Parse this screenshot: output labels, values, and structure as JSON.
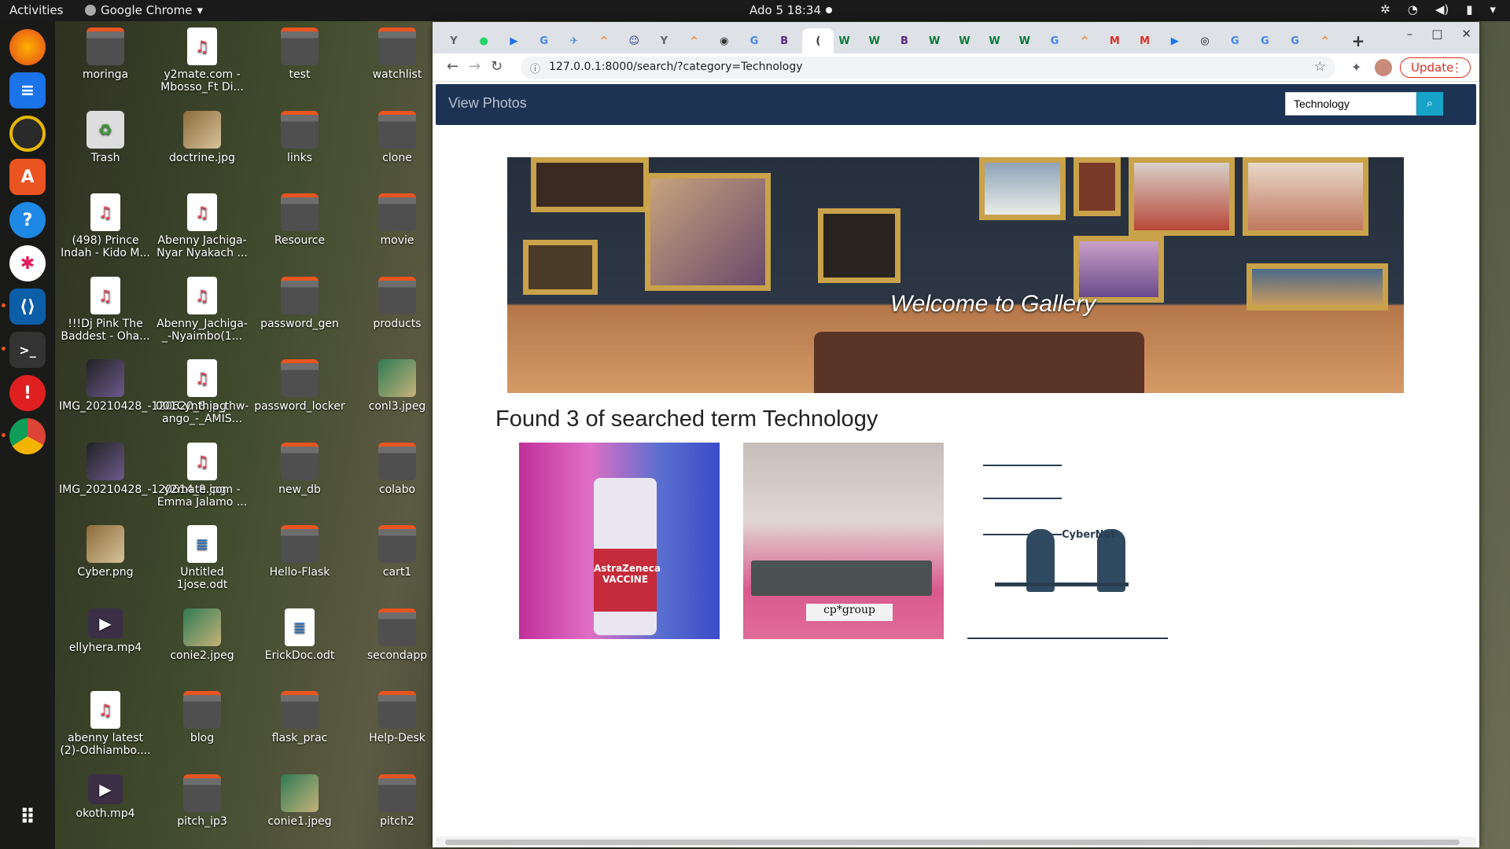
{
  "topbar": {
    "activities": "Activities",
    "app_name": "Google Chrome",
    "clock": "Ado 5  18:34"
  },
  "desktop": {
    "icons": [
      {
        "label": "moringa",
        "type": "folder"
      },
      {
        "label": "y2mate.com - Mbosso_Ft Di...",
        "type": "mp3"
      },
      {
        "label": "test",
        "type": "folder"
      },
      {
        "label": "watchlist",
        "type": "folder"
      },
      {
        "label": "Trash",
        "type": "trash"
      },
      {
        "label": "doctrine.jpg",
        "type": "image"
      },
      {
        "label": "links",
        "type": "folder"
      },
      {
        "label": "clone",
        "type": "folder"
      },
      {
        "label": "(498) Prince Indah - Kido M...",
        "type": "mp3"
      },
      {
        "label": "Abenny Jachiga-Nyar Nyakach ...",
        "type": "mp3"
      },
      {
        "label": "Resource",
        "type": "folder"
      },
      {
        "label": "movie",
        "type": "folder"
      },
      {
        "label": "!!!Dj Pink The Baddest - Oha...",
        "type": "mp3"
      },
      {
        "label": "Abenny_Jachiga-_-Nyaimbo(1...",
        "type": "mp3"
      },
      {
        "label": "password_gen",
        "type": "folder"
      },
      {
        "label": "products",
        "type": "folder"
      },
      {
        "label": "IMG_20210428_-120620_8.jpg",
        "type": "img-dark"
      },
      {
        "label": "001Cynthia_thw-ango_-_AMIS...",
        "type": "mp3"
      },
      {
        "label": "password_locker",
        "type": "folder"
      },
      {
        "label": "conl3.jpeg",
        "type": "img-green"
      },
      {
        "label": "IMG_20210428_-120614_8.jpg",
        "type": "img-dark"
      },
      {
        "label": "y2mate.com - Emma Jalamo ...",
        "type": "mp3"
      },
      {
        "label": "new_db",
        "type": "folder"
      },
      {
        "label": "colabo",
        "type": "folder"
      },
      {
        "label": "Cyber.png",
        "type": "image"
      },
      {
        "label": "Untitled 1jose.odt",
        "type": "odt"
      },
      {
        "label": "Hello-Flask",
        "type": "folder"
      },
      {
        "label": "cart1",
        "type": "folder"
      },
      {
        "label": "ellyhera.mp4",
        "type": "video"
      },
      {
        "label": "conie2.jpeg",
        "type": "img-green"
      },
      {
        "label": "ErickDoc.odt",
        "type": "odt"
      },
      {
        "label": "secondapp",
        "type": "folder"
      },
      {
        "label": "abenny latest (2)-Odhiambo....",
        "type": "mp3"
      },
      {
        "label": "blog",
        "type": "folder"
      },
      {
        "label": "flask_prac",
        "type": "folder"
      },
      {
        "label": "Help-Desk",
        "type": "folder"
      },
      {
        "label": "okoth.mp4",
        "type": "video"
      },
      {
        "label": "pitch_ip3",
        "type": "folder"
      },
      {
        "label": "conie1.jpeg",
        "type": "img-green"
      },
      {
        "label": "pitch2",
        "type": "folder"
      }
    ]
  },
  "browser": {
    "url": "127.0.0.1:8000/search/?category=Technology",
    "update_label": "Update",
    "tab_glyphs": [
      "Y",
      "●",
      "▶",
      "G",
      "✈",
      "^",
      "☺",
      "Y",
      "^",
      "◉",
      "G",
      "B",
      "(",
      "W",
      "W",
      "B",
      "W",
      "W",
      "W",
      "W",
      "G",
      "^",
      "M",
      "M",
      "▶",
      "◎",
      "G",
      "G",
      "G",
      "^"
    ],
    "new_tab_glyph": "+"
  },
  "page": {
    "brand": "View Photos",
    "search_value": "Technology",
    "hero_caption": "Welcome to Gallery",
    "result_heading": "Found 3 of searched term Technology",
    "results": [
      {
        "label": "AstraZeneca VACCINE"
      },
      {
        "label": "cp*group"
      },
      {
        "label": "CyberNet"
      }
    ]
  },
  "colors": {
    "navbar": "#1d3354",
    "search_button": "#17a2c8",
    "update_accent": "#d93025"
  }
}
